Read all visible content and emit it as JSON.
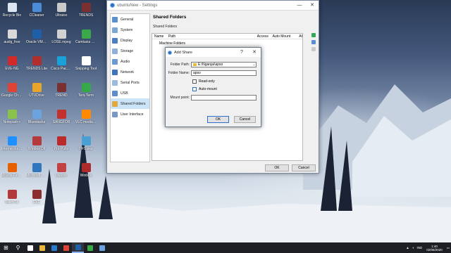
{
  "desktop_icons": [
    {
      "label": "Recycle Bin",
      "color": "#dbe6f2"
    },
    {
      "label": "CCleaner",
      "color": "#4a8cd6"
    },
    {
      "label": "Ultraiso",
      "color": "#c9c9c9"
    },
    {
      "label": "TRENDS",
      "color": "#7a3030"
    },
    {
      "label": "auslg_free",
      "color": "#d9d9d9"
    },
    {
      "label": "Oracle VM VirtualBox",
      "color": "#1f5fa8"
    },
    {
      "label": "LOSE.mpeg",
      "color": "#d1d1d1"
    },
    {
      "label": "Camtasia Studio",
      "color": "#39a94a"
    },
    {
      "label": "EVE-NG",
      "color": "#d22a2a"
    },
    {
      "label": "TRENDS Lite",
      "color": "#b02e2e"
    },
    {
      "label": "Cisco Packet Tracer",
      "color": "#1aa1d8"
    },
    {
      "label": "Snipping Tool",
      "color": "#ffffff"
    },
    {
      "label": "Google Chrome",
      "color": "#dd4437"
    },
    {
      "label": "UTVDrive",
      "color": "#e8a52c"
    },
    {
      "label": "TREND",
      "color": "#7a3030"
    },
    {
      "label": "Tera Term",
      "color": "#36a84a"
    },
    {
      "label": "Notepad++",
      "color": "#8ac34a"
    },
    {
      "label": "Bluestacks",
      "color": "#6ba3e0"
    },
    {
      "label": "SANGFOR",
      "color": "#c2312d"
    },
    {
      "label": "VLC media player",
      "color": "#ff8a00"
    },
    {
      "label": "Internet Explorer",
      "color": "#1e90ff"
    },
    {
      "label": "Winbox Dll",
      "color": "#b43b3b"
    },
    {
      "label": "Pro Putty",
      "color": "#ba2a2a"
    },
    {
      "label": "HFS.exe",
      "color": "#4a9fd4"
    },
    {
      "label": "Mozilla Firefox",
      "color": "#e66000"
    },
    {
      "label": "Microsoft Edge",
      "color": "#3277bc"
    },
    {
      "label": "uwpsnr",
      "color": "#c34141"
    },
    {
      "label": "Winbox",
      "color": "#ad2b2b"
    },
    {
      "label": "MikroTik",
      "color": "#b33a3a"
    },
    {
      "label": "EVE",
      "color": "#8d2e2e"
    }
  ],
  "settings": {
    "title": "ubuntuNew - Settings",
    "sidebar": [
      {
        "label": "General",
        "color": "#5b8fcf"
      },
      {
        "label": "System",
        "color": "#7aa7d6"
      },
      {
        "label": "Display",
        "color": "#4a7fc1"
      },
      {
        "label": "Storage",
        "color": "#8fb0d8"
      },
      {
        "label": "Audio",
        "color": "#6c9ad0"
      },
      {
        "label": "Network",
        "color": "#3d75bd"
      },
      {
        "label": "Serial Ports",
        "color": "#9abbe0"
      },
      {
        "label": "USB",
        "color": "#5e8ccc"
      },
      {
        "label": "Shared Folders",
        "color": "#e3a83d"
      },
      {
        "label": "User Interface",
        "color": "#7a98c6"
      }
    ],
    "active_index": 8,
    "page_title": "Shared Folders",
    "section": "Shared Folders",
    "columns": [
      "Name",
      "Path",
      "Access",
      "Auto Mount",
      "At"
    ],
    "machine_folders": "Machine Folders",
    "ok": "OK",
    "cancel": "Cancel"
  },
  "dialog": {
    "title": "Add Share",
    "help": "?",
    "close": "✕",
    "folder_path_label": "Folder Path:",
    "folder_path_value": "E:\\Nganjai\\apso",
    "folder_name_label": "Folder Name:",
    "folder_name_value": "apso",
    "readonly_label": "Read-only",
    "automount_label": "Auto-mount",
    "mount_point_label": "Mount point:",
    "mount_point_value": "",
    "ok": "OK",
    "cancel": "Cancel"
  },
  "taskbar": {
    "start": "⊞",
    "search": "⚲",
    "apps": [
      {
        "name": "task-view",
        "color": "#ffffff"
      },
      {
        "name": "file-explorer",
        "color": "#e8b93c"
      },
      {
        "name": "edge",
        "color": "#2a7bd0"
      },
      {
        "name": "chrome",
        "color": "#dd4437"
      },
      {
        "name": "virtualbox",
        "color": "#1f5fa8"
      },
      {
        "name": "camtasia",
        "color": "#39a94a"
      },
      {
        "name": "vm",
        "color": "#6ba3e0"
      }
    ],
    "lang": "IND",
    "time": "1:40",
    "date": "02/06/2020"
  }
}
